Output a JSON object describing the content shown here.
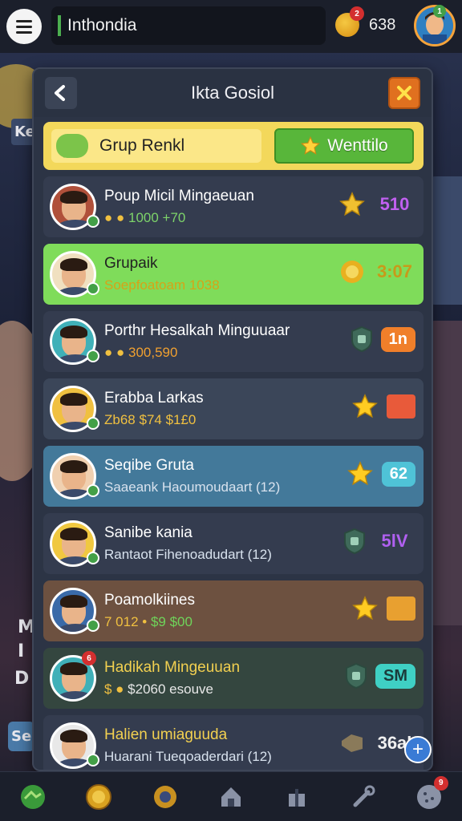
{
  "topbar": {
    "country": "Inthondia",
    "coin_badge": "2",
    "coin_count": "638",
    "avatar_badge": "1"
  },
  "background": {
    "left_letters": [
      "Ke",
      "M",
      "I",
      "D"
    ],
    "left_button": "Se"
  },
  "modal": {
    "title": "Ikta Gosiol",
    "group_label": "Grup Renkl",
    "welcome_label": "Wenttilo"
  },
  "rows": [
    {
      "name": "Poup Micil Mingaeuan",
      "sub": "1000 +70",
      "sub_prefix": "● ●",
      "score": "510",
      "score_color": "#c060f0",
      "bg": "#343c4f",
      "badge_type": "star-blue",
      "sub_color": "#7dd36a"
    },
    {
      "name": "Grupaik",
      "sub": "Soepfoatoam 1038",
      "sub_prefix": "",
      "score": "3:07",
      "score_color": "#c79a1a",
      "bg": "#7fdc5a",
      "badge_type": "sun",
      "sub_color": "#d6a317",
      "name_color": "#222"
    },
    {
      "name": "Porthr Hesalkah Minguuaar",
      "sub": "300,590",
      "sub_prefix": "● ●",
      "score": "1n",
      "score_color": "#fff",
      "bg": "#343c4f",
      "badge_type": "shield",
      "sub_color": "#f0a030",
      "pill_bg": "#f07f2a"
    },
    {
      "name": "Erabba Larkas",
      "sub": "$74 $1£0",
      "sub_prefix": "Zb68",
      "score": "",
      "score_color": "#e85a3a",
      "bg": "#3b4659",
      "badge_type": "star",
      "sub_color": "#f0c040"
    },
    {
      "name": "Seqibe Gruta",
      "sub": "Saaeank Haoumoudaart (12)",
      "sub_prefix": "",
      "score": "62",
      "score_color": "#fff",
      "bg": "#43799a",
      "badge_type": "star",
      "sub_color": "#d8e2ee",
      "pill_bg": "#4fc3d7"
    },
    {
      "name": "Sanibe kania",
      "sub": "Rantaot Fihenoadudart (12)",
      "sub_prefix": "",
      "score": "5lV",
      "score_color": "#b060f0",
      "bg": "#343c4f",
      "badge_type": "shield",
      "sub_color": "#d8e2ee"
    },
    {
      "name": "Poamolkiines",
      "sub": "$9 $00",
      "sub_prefix": "7 012 •",
      "score": "",
      "score_color": "#e8a030",
      "bg": "#6d5140",
      "badge_type": "star",
      "sub_color": "#6fd45a"
    },
    {
      "name": "Hadikah Mingeuuan",
      "sub": "$2060 esouve",
      "sub_prefix": "$ ●",
      "score": "SM",
      "score_color": "#1b3b3b",
      "bg": "#34463f",
      "badge_type": "shield",
      "sub_color": "#e8e8e8",
      "name_color": "#f2d050",
      "pill_bg": "#3fd0c4",
      "avatar_badge": "6"
    },
    {
      "name": "Halien umiaguuda",
      "sub": "Huarani Tueqoaderdari (12)",
      "sub_prefix": "",
      "score": "36al",
      "score_color": "#f0f0f0",
      "bg": "#343c4f",
      "badge_type": "tag",
      "sub_color": "#d8e2ee",
      "name_color": "#f2d050"
    }
  ],
  "bottom_nav": {
    "items": [
      "map-icon",
      "coin-icon",
      "gear-icon",
      "house-icon",
      "gift-icon",
      "tools-icon",
      "cookie-icon"
    ],
    "last_badge": "9"
  },
  "colors": {
    "accent_orange": "#e0701f",
    "accent_green": "#58b63a",
    "group_yellow": "#f3d85b"
  }
}
